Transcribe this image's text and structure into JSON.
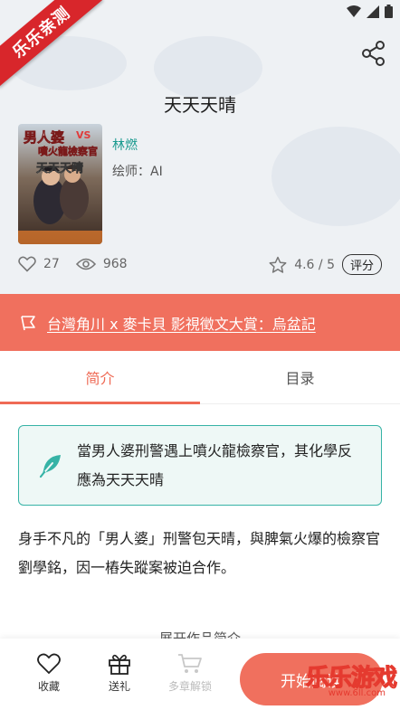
{
  "status_bar": {
    "icons": [
      "wifi-icon",
      "signal-icon",
      "battery-icon"
    ]
  },
  "ribbon": {
    "label": "乐乐亲测"
  },
  "book": {
    "title": "天天天晴",
    "author": "林燃",
    "artist": "绘师：AI",
    "cover_text": {
      "line1": "男人婆",
      "vs": "VS",
      "line2": "噴火龍檢察官",
      "line3": "天天天晴"
    }
  },
  "stats": {
    "likes": "27",
    "views": "968",
    "rating": "4.6 / 5",
    "rate_button": "评分"
  },
  "banner": {
    "text": "台灣角川 x 麥卡貝 影視徵文大賞：烏盆記"
  },
  "tabs": [
    {
      "label": "简介"
    },
    {
      "label": "目录"
    }
  ],
  "tagline": "當男人婆刑警遇上噴火龍檢察官，其化學反應為天天天晴",
  "synopsis": "身手不凡的「男人婆」刑警包天晴，與脾氣火爆的檢察官劉學銘，因一樁失蹤案被迫合作。",
  "expand_label": "展开作品简介",
  "bottom_bar": {
    "favorite": "收藏",
    "gift": "送礼",
    "multi_unlock": "多章解锁",
    "read_button": "开始阅读"
  },
  "watermark": {
    "text": "乐乐游戏",
    "url": "www.6ll.com"
  },
  "colors": {
    "accent": "#f0705e",
    "teal": "#1a9a8f",
    "ribbon": "#d8262b"
  }
}
